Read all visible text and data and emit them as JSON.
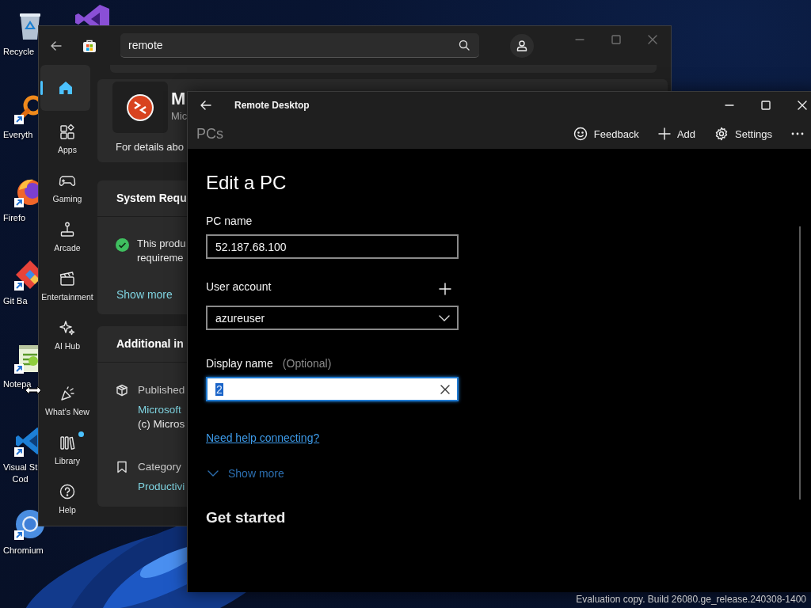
{
  "desktop": {
    "icons": [
      {
        "kind": "bin",
        "label_lines": [
          "Recycle"
        ],
        "shortcut": false
      },
      {
        "kind": "magnifier",
        "label_lines": [
          "Everyth"
        ],
        "shortcut": true
      },
      {
        "kind": "fox",
        "label_lines": [
          "Firefo"
        ],
        "shortcut": true
      },
      {
        "kind": "diamond",
        "label_lines": [
          "Git Ba"
        ],
        "shortcut": true
      },
      {
        "kind": "notepad",
        "label_lines": [
          "Notepa"
        ],
        "shortcut": true
      },
      {
        "kind": "ribbon",
        "label_lines": [
          "Visual St",
          "Cod"
        ],
        "shortcut": true
      },
      {
        "kind": "ring",
        "label_lines": [
          "Chromium"
        ],
        "shortcut": true
      }
    ],
    "second_column_icons": [
      {
        "kind": "loop"
      }
    ],
    "build_notice": "Evaluation copy. Build 26080.ge_release.240308-1400"
  },
  "store_window": {
    "search": {
      "value": "remote"
    },
    "nav_items": [
      {
        "kind": "home",
        "selected": true,
        "badge": false
      },
      {
        "kind": "apps",
        "label": "Apps",
        "selected": false,
        "badge": false
      },
      {
        "kind": "gaming",
        "label": "Gaming",
        "selected": false,
        "badge": false
      },
      {
        "kind": "arcade",
        "label": "Arcade",
        "selected": false,
        "badge": false
      },
      {
        "kind": "entertainment",
        "label": "Entertainment",
        "selected": false,
        "badge": false
      },
      {
        "kind": "ai",
        "label": "AI Hub",
        "selected": false,
        "badge": false
      }
    ],
    "nav_footer_items": [
      {
        "kind": "whats_new",
        "label": "What’s New",
        "selected": false,
        "badge": false
      },
      {
        "kind": "library",
        "label": "Library",
        "selected": false,
        "badge": true
      },
      {
        "kind": "help",
        "label": "Help",
        "selected": false,
        "badge": false
      }
    ],
    "app_header": {
      "title": "M",
      "publisher": "Mic",
      "details": "For details abo"
    },
    "sections": [
      {
        "title": "System Requ",
        "items": [
          {
            "kind": "check",
            "text_lines": [
              "This produ",
              "requireme"
            ]
          }
        ],
        "link": "Show more"
      },
      {
        "title": "Additional in",
        "items": [
          {
            "kind": "package",
            "label": "Published",
            "values": [
              {
                "text": "Microsoft",
                "link": true
              },
              {
                "text": "(c) Micros",
                "link": false
              }
            ]
          },
          {
            "kind": "bookmark",
            "label": "Category",
            "values": [
              {
                "text": "Productivi",
                "link": true
              }
            ]
          }
        ]
      }
    ]
  },
  "remote_desktop_window": {
    "title": "Remote Desktop",
    "page": "PCs",
    "toolbar": [
      {
        "kind": "feedback",
        "label": "Feedback"
      },
      {
        "kind": "add",
        "label": "Add"
      },
      {
        "kind": "settings",
        "label": "Settings"
      },
      {
        "kind": "more"
      }
    ],
    "heading": "Edit a PC",
    "fields": [
      {
        "kind": "text",
        "label": "PC name",
        "value": "52.187.68.100",
        "focused": false
      },
      {
        "kind": "dropdown",
        "label": "User account",
        "value": "azureuser",
        "add_button": true,
        "focused": false
      },
      {
        "kind": "text",
        "label": "Display name",
        "hint": "(Optional)",
        "value": "2",
        "focused": true,
        "clear_button": true
      }
    ],
    "help_link": "Need help connecting?",
    "show_more": "Show more",
    "section_heading": "Get started"
  }
}
